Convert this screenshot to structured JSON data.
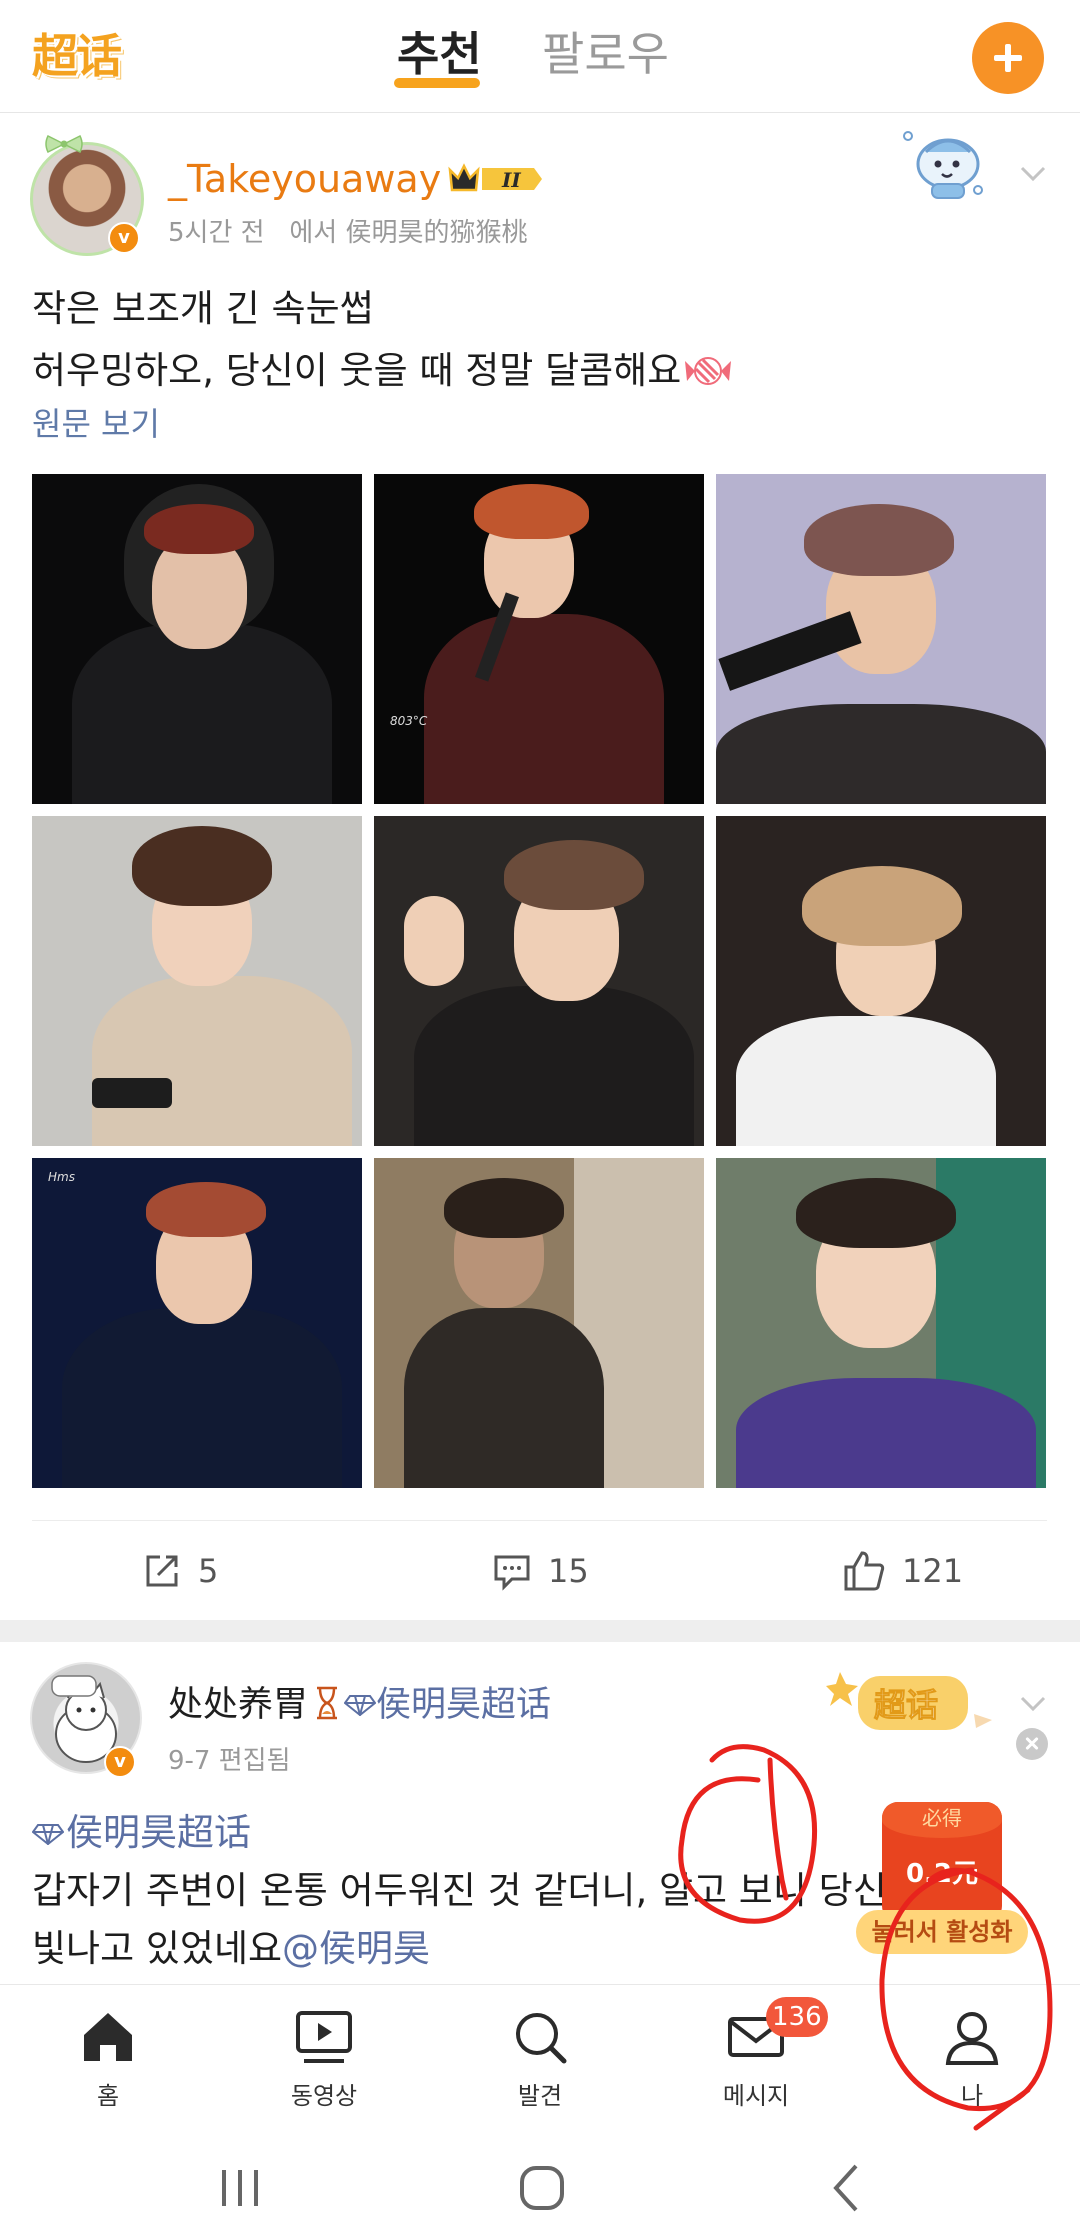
{
  "header": {
    "logo_text": "超话",
    "tabs": [
      {
        "label": "추천",
        "active": true
      },
      {
        "label": "팔로우",
        "active": false
      }
    ],
    "accent": "#f7a31d"
  },
  "post1": {
    "username": "_Takeyouaway",
    "level_badge": "II",
    "time": "5시간 전",
    "source": "에서 侯明昊的猕猴桃",
    "text_line1": "작은 보조개 긴 속눈썹",
    "text_line2": "허우밍하오, 당신이 웃을 때 정말 달콤해요",
    "view_original": "원문 보기",
    "photo_watermark_1": "803°C",
    "photo_watermark_2": "Hms",
    "repost_count": "5",
    "comment_count": "15",
    "like_count": "121"
  },
  "post2": {
    "username": "处处养胃",
    "topic": "侯明昊超话",
    "meta": "9-7  편집됨",
    "badge_text": "超话",
    "topic_tag": "侯明昊超话",
    "text_a": "갑자기 주변이 온통 어두워진 것 같더니, 알고 보니 당신이 가",
    "text_b": "빛나고 있었네요",
    "mention": "@侯明昊"
  },
  "redpacket": {
    "must_get": "必得",
    "value": "0.2元",
    "button": "눌러서 활성화"
  },
  "bottom_nav": {
    "items": [
      {
        "label": "홈",
        "icon": "home-icon"
      },
      {
        "label": "동영상",
        "icon": "video-icon"
      },
      {
        "label": "발견",
        "icon": "search-icon"
      },
      {
        "label": "메시지",
        "icon": "mail-icon"
      },
      {
        "label": "나",
        "icon": "profile-icon"
      }
    ],
    "message_badge": "136"
  },
  "colors": {
    "username": "#e97b12",
    "link": "#5b6fa3",
    "annotation": "#e8231d"
  }
}
